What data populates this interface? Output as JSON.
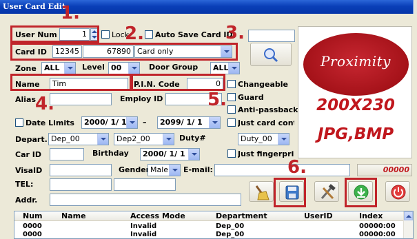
{
  "window": {
    "title": "User Card Edit"
  },
  "annotations": [
    "1.",
    "2.",
    "3.",
    "4.",
    "5.",
    "6."
  ],
  "form": {
    "user_num_label": "User Num",
    "user_num_value": "1",
    "lock_label": "Lock",
    "auto_save_label": "Auto Save Card ID",
    "card_id_label": "Card ID",
    "card_id_part1": "12345",
    "card_id_part2": "67890",
    "card_mode": "Card only",
    "zone_label": "Zone",
    "zone_value": "ALL",
    "level_label": "Level",
    "level_value": "00",
    "door_group_label": "Door Group",
    "door_group_value": "ALL",
    "name_label": "Name",
    "name_value": "Tim",
    "pin_label": "P.I.N. Code",
    "pin_value": "0",
    "changeable_label": "Changeable",
    "alias_label": "Alias",
    "employ_id_label": "Employ ID",
    "guard_label": "Guard",
    "anti_passback_label": "Anti-passback",
    "date_limits_label": "Date Limits",
    "date_from": "2000/ 1/ 1",
    "date_dash": "–",
    "date_to": "2099/ 1/ 1",
    "just_card_label": "Just card contro",
    "depart_label": "Depart.",
    "depart_value": "Dep_00",
    "dep2_value": "Dep2_00",
    "duty_label": "Duty#",
    "duty_value": "Duty_00",
    "car_id_label": "Car ID",
    "birthday_label": "Birthday",
    "birthday_value": "2000/ 1/ 1",
    "just_fingerprint_label": "Just fingerprin",
    "visa_label": "VisaID",
    "gender_label": "Gender",
    "gender_value": "Male",
    "email_label": "E-mail:",
    "code_value": "00000",
    "tel_label": "TEL:",
    "addr_label": "Addr."
  },
  "photo": {
    "title": "Proximity",
    "size": "200X230",
    "formats": "JPG,BMP"
  },
  "toolbar": {
    "clean_icon": "broom-icon",
    "save_icon": "floppy-disk-icon",
    "tools_icon": "hammer-wrench-icon",
    "download_icon": "download-arrow-icon",
    "power_icon": "power-icon",
    "search_icon": "magnifier-icon"
  },
  "table": {
    "headers": [
      "Num",
      "Name",
      "Access Mode",
      "Department",
      "UserID",
      "Index"
    ],
    "rows": [
      [
        "0000",
        "",
        "Invalid",
        "Dep_00",
        "",
        "00000:00"
      ],
      [
        "0000",
        "",
        "Invalid",
        "Dep_00",
        "",
        "00000:00"
      ]
    ]
  },
  "colors": {
    "accent_red": "#c0242a",
    "title_blue": "#0a3fb8",
    "dialog_bg": "#ece9d8"
  }
}
